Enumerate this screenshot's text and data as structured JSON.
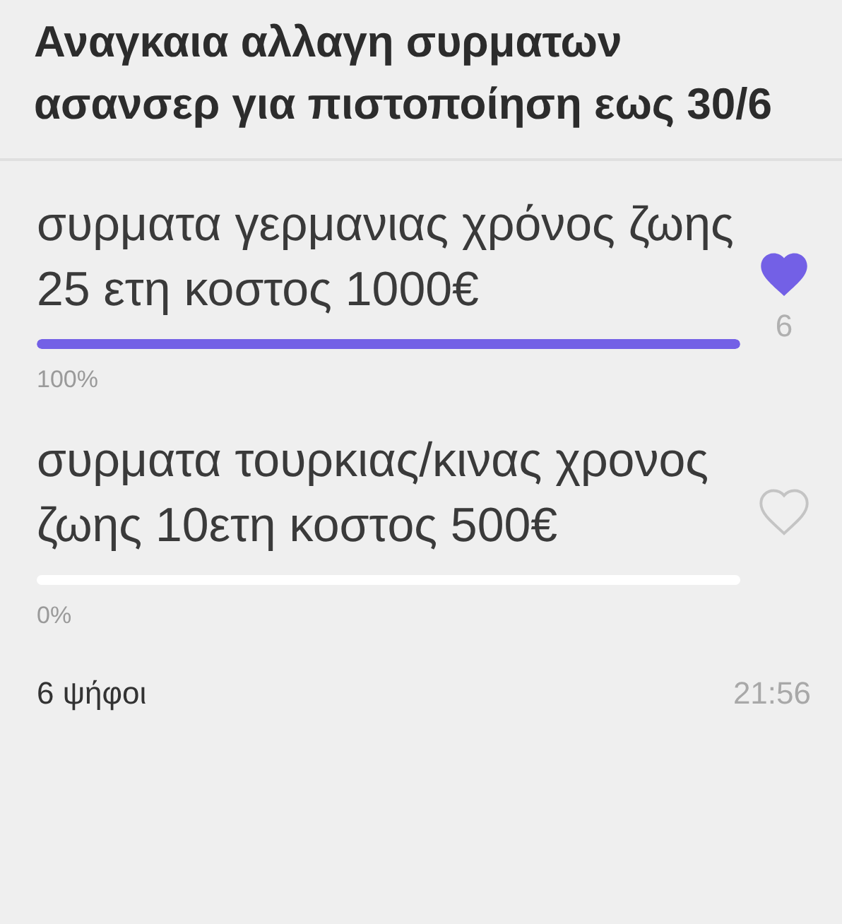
{
  "poll": {
    "question": "Αναγκαια αλλαγη συρματων ασανσερ για πιστοποίηση εως 30/6",
    "options": [
      {
        "text": "συρματα γερμανιας χρόνος ζωης 25 ετη κοστος 1000€",
        "level": 1,
        "percent": "100%",
        "liked": true,
        "count": "6"
      },
      {
        "text": "συρματα τουρκιας/κινας χρονος ζωης 10ετη κοστος 500€",
        "level": 0,
        "percent": "0%",
        "liked": false
      }
    ],
    "votes": "6 ψήφοι",
    "time": "21:56"
  }
}
